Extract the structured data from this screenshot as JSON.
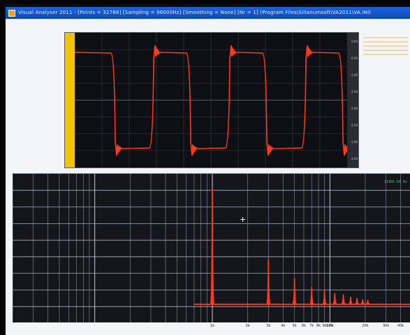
{
  "window": {
    "title": "Visual Analyser 2011 - [Points = 32768] [Sampling = 96000Hz] [Smoothing = None] [Nr = 1] (Program Files\\Sillanumsoft\\VA2011\\VA.INI)",
    "accent": "#1d62d8"
  },
  "scope": {
    "trace_color": "#ff3a1a",
    "marker_color": "#f2c400",
    "scale_labels": [
      "0.00",
      "-0.50",
      "-1.00",
      "-1.50",
      "-2.00",
      "-2.50",
      "-3.00",
      "-3.50"
    ]
  },
  "spectrum": {
    "readout": "11365.66 Hz",
    "trace_color": "#ff3a1a",
    "axis_labels": [
      {
        "text": "1k",
        "freq": 1000
      },
      {
        "text": "2k",
        "freq": 2000
      },
      {
        "text": "3k",
        "freq": 3000
      },
      {
        "text": "4k",
        "freq": 4000
      },
      {
        "text": "5k",
        "freq": 5000
      },
      {
        "text": "6k",
        "freq": 6000
      },
      {
        "text": "7k",
        "freq": 7000
      },
      {
        "text": "8k",
        "freq": 8000
      },
      {
        "text": "9k",
        "freq": 9000
      },
      {
        "text": "10k",
        "freq": 10000
      },
      {
        "text": "20k",
        "freq": 20000
      },
      {
        "text": "30k",
        "freq": 30000
      },
      {
        "text": "40k",
        "freq": 40000
      }
    ],
    "harmonics": [
      {
        "freq": 1000,
        "level": 0.95
      },
      {
        "freq": 3000,
        "level": 0.37
      },
      {
        "freq": 5000,
        "level": 0.21
      },
      {
        "freq": 7000,
        "level": 0.14
      },
      {
        "freq": 9000,
        "level": 0.11
      },
      {
        "freq": 11000,
        "level": 0.09
      },
      {
        "freq": 13000,
        "level": 0.08
      },
      {
        "freq": 15000,
        "level": 0.06
      },
      {
        "freq": 17000,
        "level": 0.05
      },
      {
        "freq": 19000,
        "level": 0.04
      },
      {
        "freq": 21000,
        "level": 0.035
      }
    ]
  }
}
